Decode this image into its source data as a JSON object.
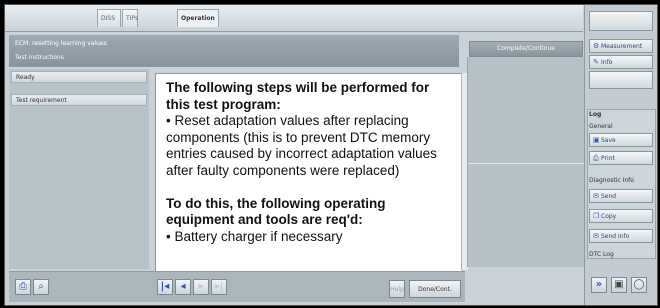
{
  "tabs": [
    "DISS",
    "TIPs",
    "Operation"
  ],
  "header": {
    "line1": "ECM: resetting learning values",
    "line2": "Test instructions"
  },
  "status_items": [
    "Ready",
    "Test requirement"
  ],
  "content": {
    "heading1": "The following steps will be performed for this test program:",
    "bullet1": "• Reset adaptation values after replacing components (this is to prevent DTC memory entries caused by incorrect adaptation values after faulty components were replaced)",
    "heading2": "To do this, the following operating equipment and tools are req'd:",
    "bullet2": "• Battery charger if necessary"
  },
  "complete_button": "Complete/Continue",
  "bottom": {
    "help_label": "Help",
    "done_label": "Done/Cont."
  },
  "sidebar": {
    "measurement": "Measurement",
    "info": "Info",
    "log_title": "Log",
    "general_label": "General",
    "save": "Save",
    "print": "Print",
    "diag_label": "Diagnostic Info",
    "send": "Send",
    "copy": "Copy",
    "send_info": "Send info",
    "dtc_label": "DTC Log"
  },
  "colors": {
    "panel_bg": "#c9d2d8",
    "header_bg": "#8795a0",
    "nav_icon_blue": "#2f4fae"
  },
  "icons": [
    "print-icon",
    "search-icon",
    "first-page-icon",
    "back-icon",
    "forward-icon",
    "last-page-icon",
    "gear-icon",
    "wrench-icon",
    "chevron-right-icon"
  ]
}
